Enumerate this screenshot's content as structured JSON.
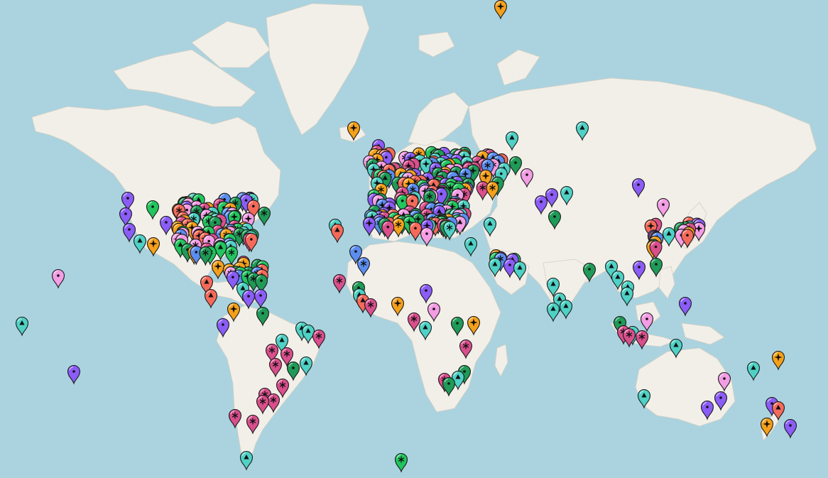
{
  "map": {
    "colors": {
      "ocean": "#aad3df",
      "land": "#f2efe9",
      "land_stroke": "#d6cfc2",
      "pin_outline": "#1a1a1a"
    },
    "pin_styles": {
      "orange": "#f5a01a",
      "teal": "#4fd1c5",
      "violet": "#8b5cf6",
      "pink": "#f39de4",
      "salmon": "#f46a5a",
      "magenta": "#d94f8c",
      "green": "#1f9a57",
      "lime": "#22c55e",
      "blue": "#5b8def"
    },
    "pin_glyphs": [
      "star4",
      "tri",
      "dot",
      "asterisk"
    ]
  }
}
